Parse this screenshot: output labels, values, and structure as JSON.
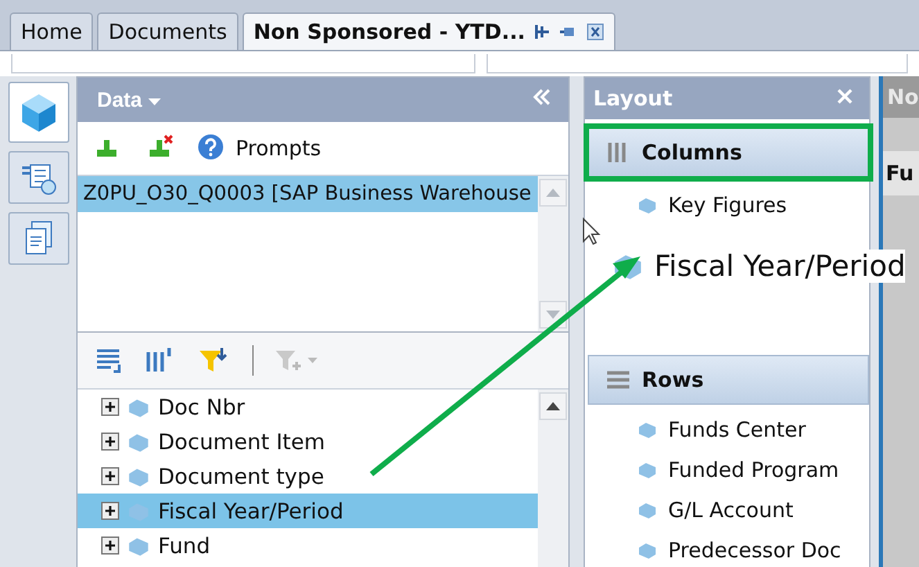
{
  "tabs": [
    {
      "label": "Home",
      "selected": false
    },
    {
      "label": "Documents",
      "selected": false
    },
    {
      "label": "Non Sponsored - YTD...",
      "selected": true
    }
  ],
  "side_buttons": [
    {
      "selected": true
    },
    {
      "selected": false
    },
    {
      "selected": false
    }
  ],
  "data_panel": {
    "title": "Data",
    "prompts": "Prompts",
    "queries": [
      {
        "label": "Z0PU_O30_Q0003 [SAP Business Warehouse",
        "selected": true
      }
    ],
    "objects": [
      {
        "label": "Doc Nbr",
        "selected": false
      },
      {
        "label": "Document Item",
        "selected": false
      },
      {
        "label": "Document type",
        "selected": false
      },
      {
        "label": "Fiscal Year/Period",
        "selected": true
      },
      {
        "label": "Fund",
        "selected": false
      }
    ]
  },
  "layout_panel": {
    "title": "Layout",
    "columns": {
      "title": "Columns",
      "highlighted": true,
      "items": [
        "Key Figures"
      ]
    },
    "drag_item": "Fiscal Year/Period",
    "rows": {
      "title": "Rows",
      "items": [
        "Funds Center",
        "Funded Program",
        "G/L Account",
        "Predecessor Doc"
      ]
    }
  },
  "right_panel": {
    "title": "No",
    "column_1": "Fu"
  }
}
